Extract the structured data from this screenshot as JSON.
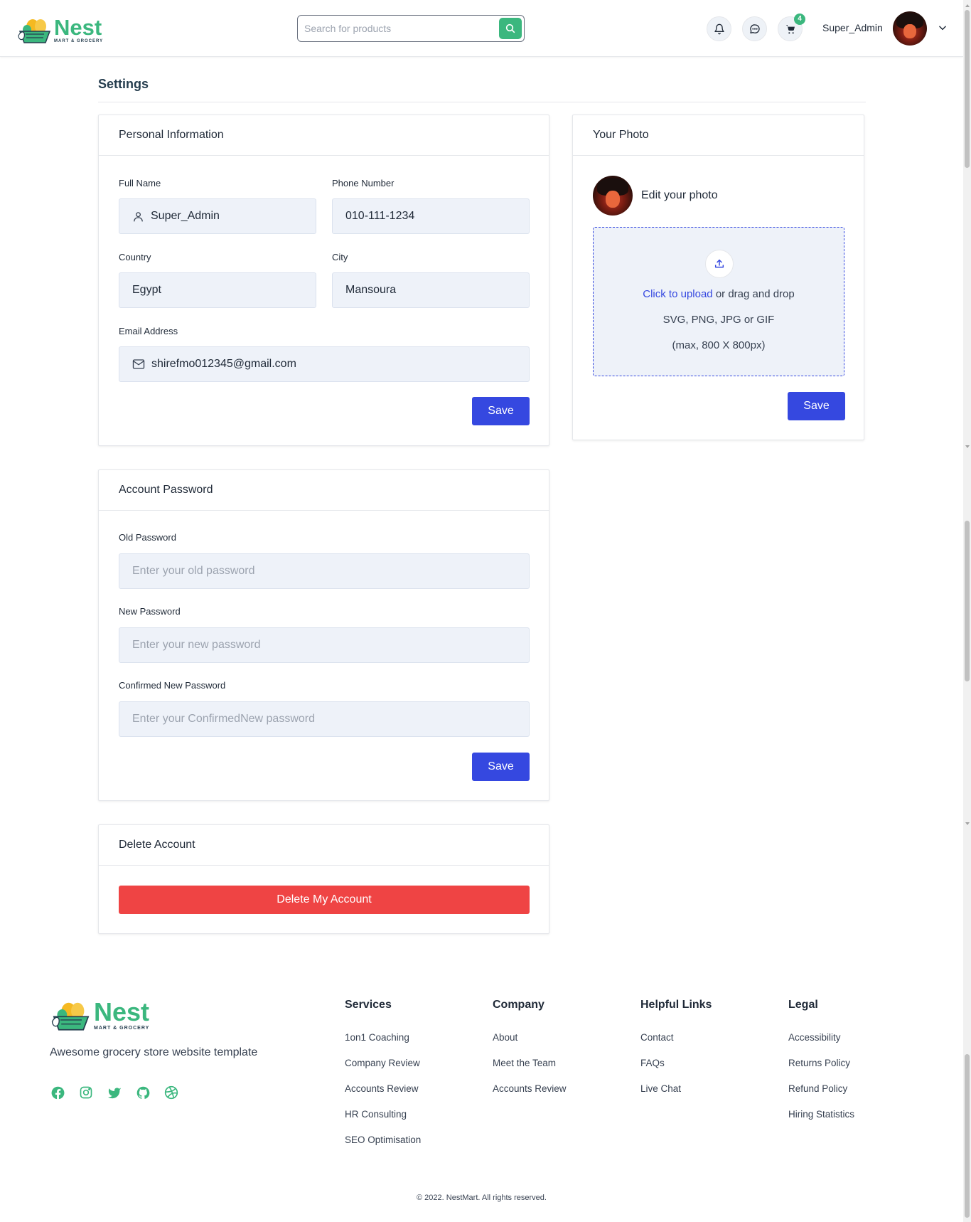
{
  "header": {
    "logo": {
      "brand": "Nest",
      "tagline": "MART & GROCERY"
    },
    "search": {
      "placeholder": "Search for products"
    },
    "cart_count": "4",
    "username": "Super_Admin"
  },
  "page": {
    "title": "Settings"
  },
  "personal": {
    "title": "Personal Information",
    "full_name_label": "Full Name",
    "full_name_value": "Super_Admin",
    "phone_label": "Phone Number",
    "phone_value": "010-111-1234",
    "country_label": "Country",
    "country_value": "Egypt",
    "city_label": "City",
    "city_value": "Mansoura",
    "email_label": "Email Address",
    "email_value": "shirefmo012345@gmail.com",
    "save_label": "Save"
  },
  "photo": {
    "title": "Your Photo",
    "edit_label": "Edit your photo",
    "upload_link": "Click to upload",
    "upload_rest": " or drag and drop",
    "formats": "SVG, PNG, JPG or GIF",
    "max_size": "(max, 800 X 800px)",
    "save_label": "Save"
  },
  "password": {
    "title": "Account Password",
    "old_label": "Old Password",
    "old_placeholder": "Enter your old password",
    "new_label": "New Password",
    "new_placeholder": "Enter your new password",
    "confirm_label": "Confirmed New Password",
    "confirm_placeholder": "Enter your ConfirmedNew password",
    "save_label": "Save"
  },
  "delete": {
    "title": "Delete Account",
    "button_label": "Delete My Account"
  },
  "footer": {
    "logo": {
      "brand": "Nest",
      "tagline": "MART & GROCERY"
    },
    "tagline": "Awesome grocery store website template",
    "social_icons": [
      "facebook-icon",
      "instagram-icon",
      "twitter-icon",
      "github-icon",
      "dribbble-icon"
    ],
    "columns": [
      {
        "title": "Services",
        "links": [
          "1on1 Coaching",
          "Company Review",
          "Accounts Review",
          "HR Consulting",
          "SEO Optimisation"
        ]
      },
      {
        "title": "Company",
        "links": [
          "About",
          "Meet the Team",
          "Accounts Review"
        ]
      },
      {
        "title": "Helpful Links",
        "links": [
          "Contact",
          "FAQs",
          "Live Chat"
        ]
      },
      {
        "title": "Legal",
        "links": [
          "Accessibility",
          "Returns Policy",
          "Refund Policy",
          "Hiring Statistics"
        ]
      }
    ],
    "copyright": "© 2022. NestMart. All rights reserved."
  },
  "colors": {
    "brand_green": "#3bb77e",
    "primary_blue": "#3548e0",
    "danger_red": "#ef4444",
    "field_bg": "#eef2f9"
  }
}
